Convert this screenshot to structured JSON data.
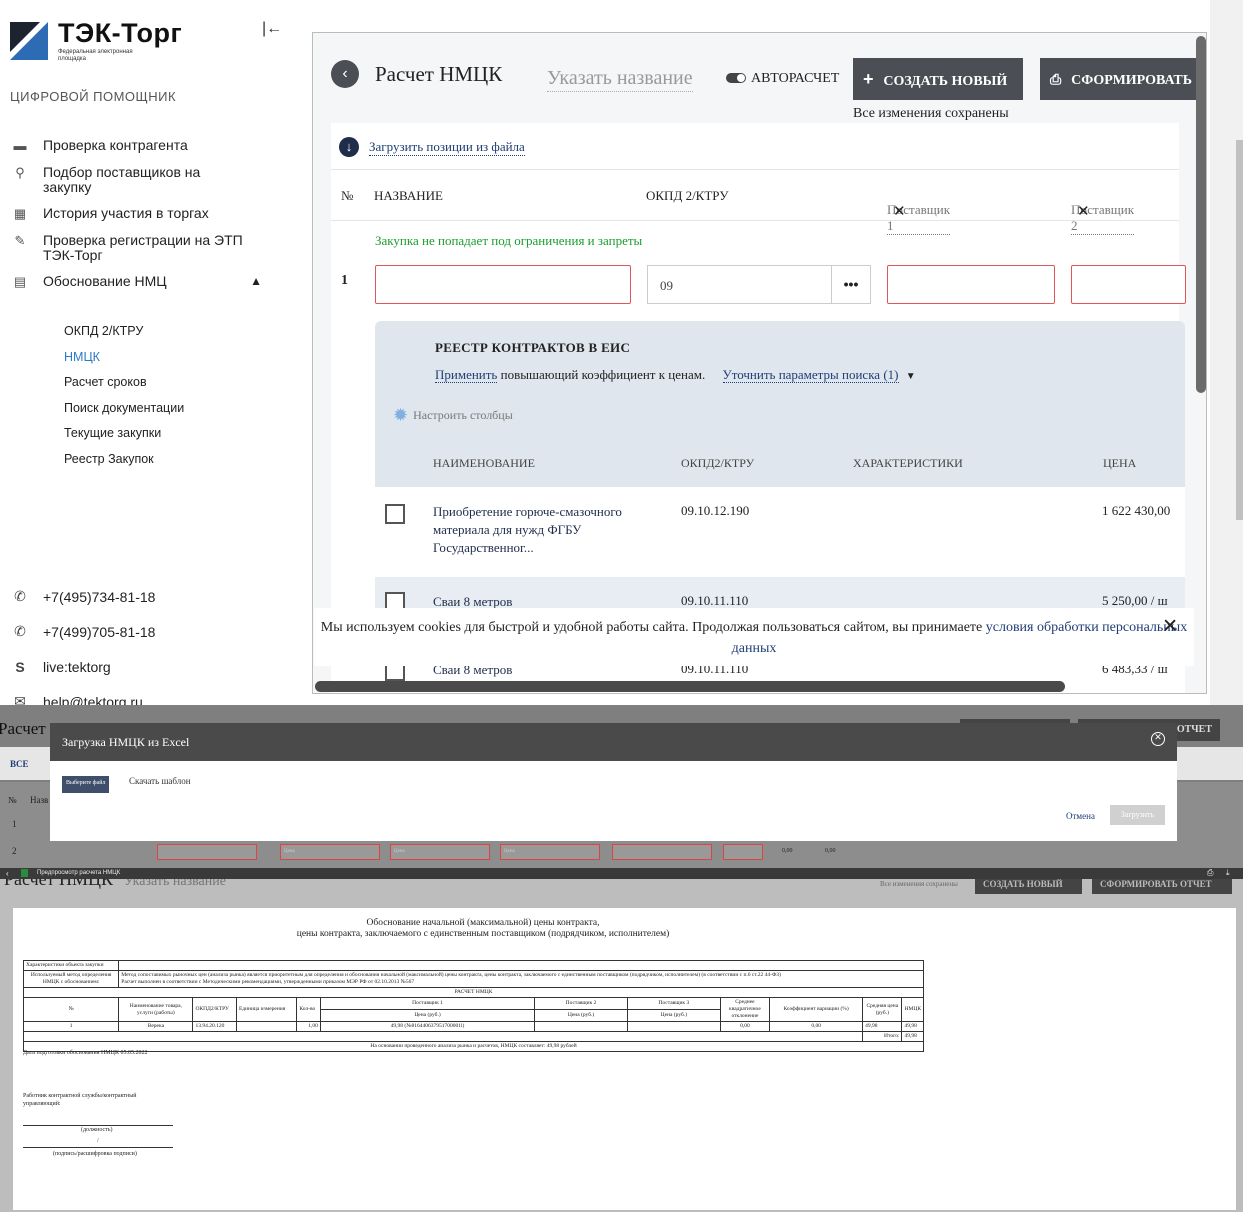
{
  "sidebar": {
    "brand": "ТЭК-Торг",
    "brand_sub": "Федеральная электронная площадка",
    "collapse": "|←",
    "assistant": "ЦИФРОВОЙ ПОМОЩНИК",
    "nav": [
      {
        "label": "Проверка контрагента",
        "icon": "briefcase-icon"
      },
      {
        "label": "Подбор поставщиков на закупку",
        "icon": "search-supplier-icon"
      },
      {
        "label": "История участия в торгах",
        "icon": "history-icon"
      },
      {
        "label": "Проверка регистрации на ЭТП ТЭК-Торг",
        "icon": "registration-icon"
      },
      {
        "label": "Обоснование НМЦ",
        "icon": "table-icon"
      }
    ],
    "sub": [
      "ОКПД 2/КТРУ",
      "НМЦК",
      "Расчет сроков",
      "Поиск документации",
      "Текущие закупки",
      "Реестр Закупок"
    ],
    "contacts": [
      {
        "text": "+7(495)734-81-18",
        "icon": "phone-icon"
      },
      {
        "text": "+7(499)705-81-18",
        "icon": "phone-icon"
      },
      {
        "text": "live:tektorg",
        "icon": "skype-icon"
      },
      {
        "text": "help@tektorg.ru",
        "icon": "mail-icon"
      }
    ]
  },
  "main": {
    "title": "Расчет НМЦК",
    "name_placeholder": "Указать название",
    "autocalc": "АВТОРАСЧЕТ",
    "create_btn": "СОЗДАТЬ НОВЫЙ",
    "form_btn": "СФОРМИРОВАТЬ",
    "saved": "Все изменения сохранены",
    "upload_link": "Загрузить позиции из файла",
    "col_num": "№",
    "col_name": "НАЗВАНИЕ",
    "col_okpd": "ОКПД 2/КТРУ",
    "supplier1": "Поставщик 1",
    "supplier2": "Поставщик 2",
    "ok_msg": "Закупка не попадает под ограничения и запреты",
    "row_num": "1",
    "okpd_value": "09",
    "dots": "•••",
    "registry": {
      "title": "РЕЕСТР КОНТРАКТОВ В ЕИС",
      "apply": "Применить",
      "apply_rest": " повышающий коэффициент к ценам.",
      "refine": "Уточнить параметры поиска (1)",
      "configure": "Настроить столбцы",
      "h_name": "НАИМЕНОВАНИЕ",
      "h_okpd": "ОКПД2/КТРУ",
      "h_char": "ХАРАКТЕРИСТИКИ",
      "h_price": "ЦЕНА",
      "rows": [
        {
          "name": "Приобретение горюче-смазочного материала для нужд ФГБУ Государственног...",
          "code": "09.10.12.190",
          "price": "1 622 430,00"
        },
        {
          "name": "Сваи 8 метров",
          "code": "09.10.11.110",
          "price": "5 250,00  /  ш"
        },
        {
          "name": "Сваи 8 метров",
          "code": "09.10.11.110",
          "price": "6 483,33  /  ш"
        }
      ]
    },
    "cookies_text": "Мы используем cookies для быстрой и удобной работы сайта. Продолжая пользоваться сайтом, вы принимаете ",
    "cookies_link": "условия обработки персональных данных"
  },
  "mid": {
    "bg_title": "Расчет НМЦК",
    "bg_btn": "ОТЧЕТ",
    "all": "ВСЕ",
    "col_num": "№",
    "col_name": "Назв",
    "r1": "1",
    "r2": "2",
    "price_ph": "Цена",
    "v1": "0,00",
    "v2": "0,00",
    "modal_title": "Загрузка НМЦК из Excel",
    "pick_file": "Выберите файл",
    "template": "Скачать шаблон",
    "cancel": "Отмена",
    "upload": "Загрузить"
  },
  "preview": {
    "bar_title": "Предпросмотр расчета НМЦК",
    "bg_title": "Расчет НМЦК",
    "bg_name": "Указать название",
    "bg_saved": "Все изменения сохранены",
    "bg_create": "СОЗДАТЬ НОВЫЙ",
    "bg_form": "СФОРМИРОВАТЬ ОТЧЕТ",
    "doc_title_1": "Обоснование начальной (максимальной) цены контракта,",
    "doc_title_2": "цены контракта, заключаемого с единственным поставщиком (подрядчиком, исполнителем)",
    "char_label": "Характеристики объекта закупки",
    "method_label": "Используемый метод определения НМЦК с обоснованием:",
    "method_text_1": "Метод сопоставимых рыночных цен (анализа рынка) является приоритетным для определения и обоснования начальной (максимальной) цены контракта, цены контракта, заключаемого с единственным поставщиком (подрядчиком, исполнителем) (в соответствии с п.6 ст.22 44-ФЗ)",
    "method_text_2": "Расчет выполнен в соответствии с Методическими рекомендациями, утвержденными приказом МЭР РФ от 02.10.2013 №567",
    "calc_header": "РАСЧЕТ НМЦК",
    "h": [
      "№",
      "Наименование товара, услуги (работы)",
      "ОКПД2/КТРУ",
      "Единица измерения",
      "Кол-во",
      "Поставщик 1",
      "Поставщик 2",
      "Поставщик 3",
      "Среднее квадратичное отклонение",
      "Коэффициент вариации (%)",
      "Средняя цена (руб.)",
      "НМЦК"
    ],
    "price_rub": "Цена (руб.)",
    "row": [
      "1",
      "Верека",
      "13.94.20.120",
      "",
      "1,00",
      "49,98 (№816440637951700001l)",
      "",
      "",
      "0,00",
      "0,00",
      "49,98",
      "49,98"
    ],
    "total_label": "Итого:",
    "total": "49,98",
    "conclusion": "На основании проведенного анализа рынка и расчетов, НМЦК составляет: 49,98 рублей",
    "date_line": "Дата подготовки обоснования НМЦК 05.05.2022",
    "worker": "Работник контрактной службы/контрактный управляющий:",
    "position": "(должность)",
    "slash": "/",
    "signature": "(подпись/расшифровка подписи)"
  }
}
